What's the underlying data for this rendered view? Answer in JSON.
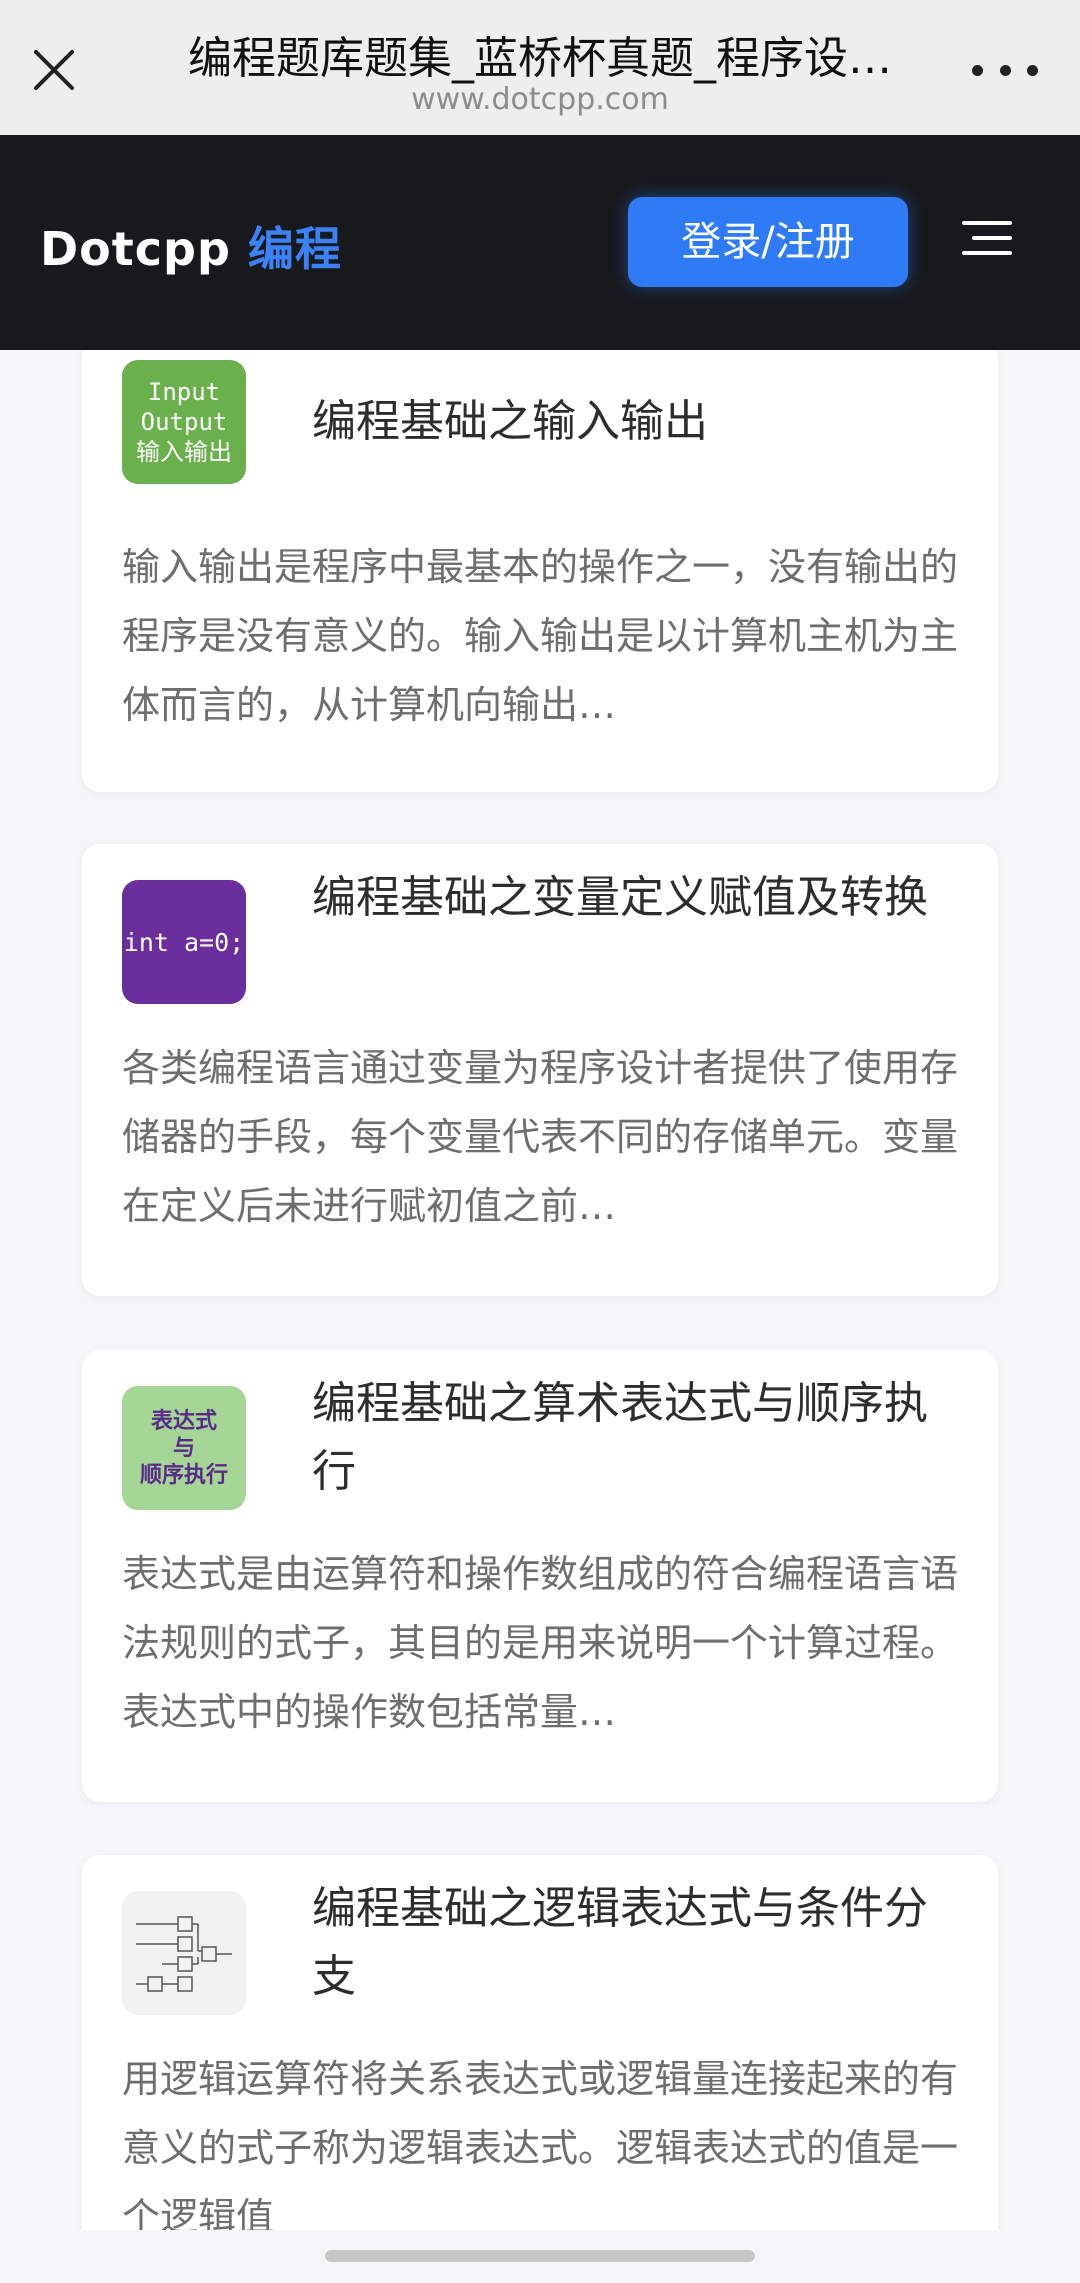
{
  "browser": {
    "title": "编程题库题集_蓝桥杯真题_程序设…",
    "url": "www.dotcpp.com",
    "close_icon": "close-icon",
    "more_icon": "more-icon"
  },
  "site_header": {
    "logo_main": "Dotcpp",
    "logo_accent": "编程",
    "login_label": "登录/注册",
    "menu_icon": "hamburger-menu-icon",
    "accent_color": "#2f7bf6"
  },
  "cards": [
    {
      "title": "编程基础之输入输出",
      "description": "输入输出是程序中最基本的操作之一，没有输出的程序是没有意义的。输入输出是以计算机主机为主体而言的，从计算机向输出…",
      "thumb_lines": [
        "Input",
        "Output",
        "输入输出"
      ]
    },
    {
      "title": "编程基础之变量定义赋值及转换",
      "description": "各类编程语言通过变量为程序设计者提供了使用存储器的手段，每个变量代表不同的存储单元。变量在定义后未进行赋初值之前…",
      "thumb_text": "int a=0;"
    },
    {
      "title": "编程基础之算术表达式与顺序执行",
      "description": "表达式是由运算符和操作数组成的符合编程语言语法规则的式子，其目的是用来说明一个计算过程。表达式中的操作数包括常量…",
      "thumb_lines": [
        "表达式",
        "与",
        "顺序执行"
      ]
    },
    {
      "title": "编程基础之逻辑表达式与条件分支",
      "description": "用逻辑运算符将关系表达式或逻辑量连接起来的有意义的式子称为逻辑表达式。逻辑表达式的值是一个逻辑值",
      "thumb_icon": "logic-circuit-icon"
    }
  ]
}
